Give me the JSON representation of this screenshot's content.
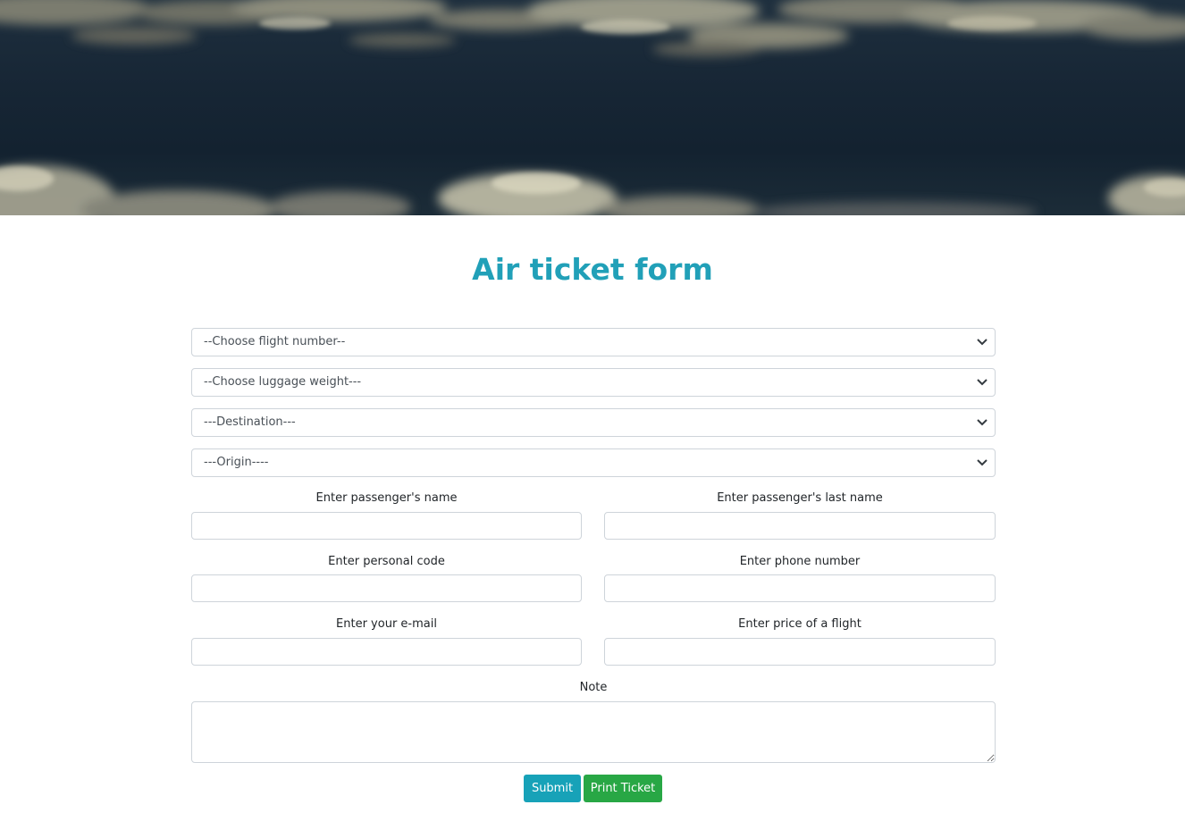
{
  "page": {
    "title": "Air ticket form",
    "accent_color": "#21a0b8"
  },
  "hero": {
    "image": "clouds-over-sky-banner"
  },
  "selects": {
    "flight_number": "--Choose flight number--",
    "luggage_weight": "--Choose luggage weight---",
    "destination": "---Destination---",
    "origin": "---Origin----"
  },
  "fields": {
    "name_label": "Enter passenger's name",
    "last_name_label": "Enter passenger's last name",
    "personal_code_label": "Enter personal code",
    "phone_label": "Enter phone number",
    "email_label": "Enter your e-mail",
    "price_label": "Enter price of a flight",
    "note_label": "Note"
  },
  "buttons": {
    "submit": "Submit",
    "print": "Print Ticket",
    "submit_color": "#17a2b8",
    "print_color": "#28a745"
  }
}
